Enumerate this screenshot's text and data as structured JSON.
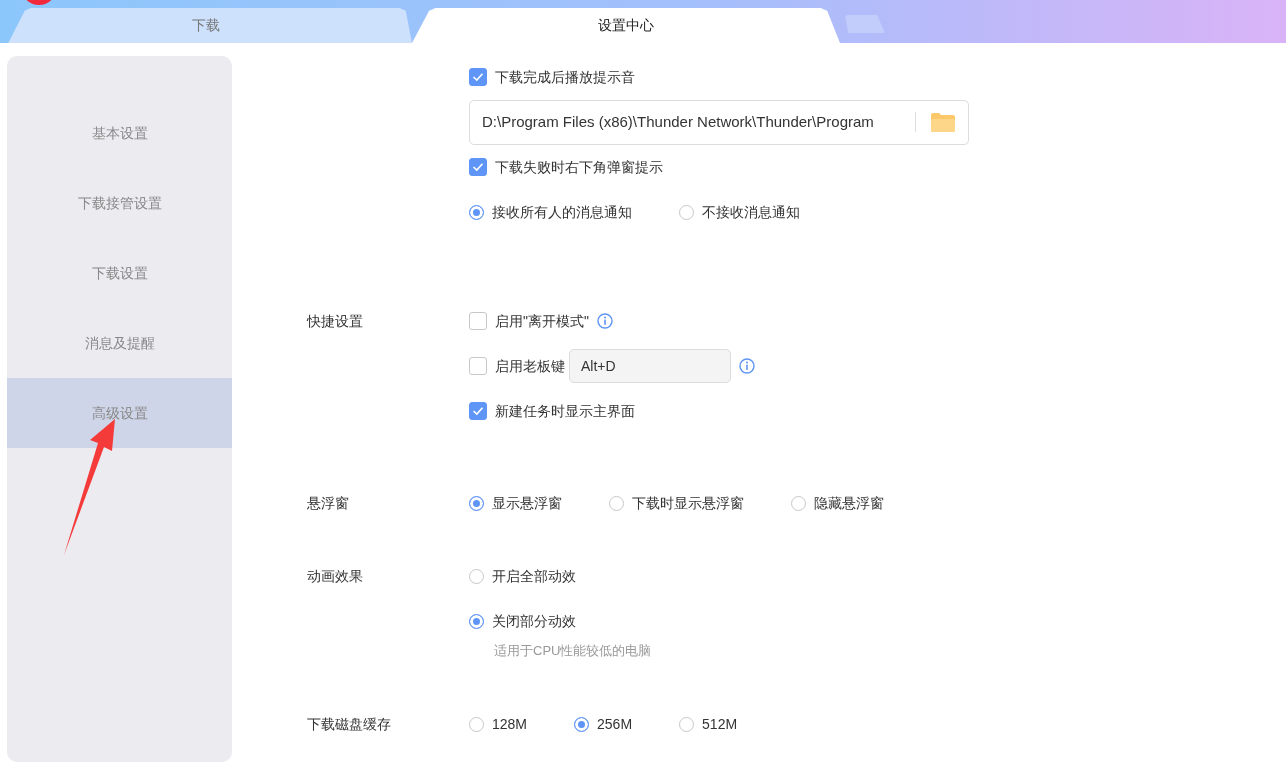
{
  "tabs": [
    {
      "label": "下载",
      "selected": false
    },
    {
      "label": "设置中心",
      "selected": true
    }
  ],
  "sidebar": {
    "items": [
      {
        "label": "基本设置",
        "selected": false
      },
      {
        "label": "下载接管设置",
        "selected": false
      },
      {
        "label": "下载设置",
        "selected": false
      },
      {
        "label": "消息及提醒",
        "selected": false
      },
      {
        "label": "高级设置",
        "selected": true
      }
    ]
  },
  "sections": [
    {
      "items": [
        {
          "kind": "checkbox",
          "label": "下载完成后播放提示音",
          "checked": true
        },
        {
          "kind": "path",
          "value": "D:\\Program Files (x86)\\Thunder Network\\Thunder\\Program"
        },
        {
          "kind": "checkbox",
          "label": "下载失败时右下角弹窗提示",
          "checked": true
        },
        {
          "kind": "radios",
          "options": [
            {
              "label": "接收所有人的消息通知",
              "selected": true
            },
            {
              "label": "不接收消息通知",
              "selected": false
            }
          ]
        }
      ]
    },
    {
      "label": "快捷设置",
      "items": [
        {
          "kind": "checkbox",
          "label": "启用\"离开模式\"",
          "checked": false,
          "info": true
        },
        {
          "kind": "checkbox",
          "label": "启用老板键",
          "checked": false,
          "hotkey": "Alt+D",
          "info": true
        },
        {
          "kind": "checkbox",
          "label": "新建任务时显示主界面",
          "checked": true
        }
      ]
    },
    {
      "label": "悬浮窗",
      "items": [
        {
          "kind": "radios",
          "options": [
            {
              "label": "显示悬浮窗",
              "selected": true
            },
            {
              "label": "下载时显示悬浮窗",
              "selected": false
            },
            {
              "label": "隐藏悬浮窗",
              "selected": false
            }
          ]
        }
      ]
    },
    {
      "label": "动画效果",
      "items": [
        {
          "kind": "radios",
          "options": [
            {
              "label": "开启全部动效",
              "selected": false
            }
          ]
        },
        {
          "kind": "radios",
          "options": [
            {
              "label": "关闭部分动效",
              "selected": true
            }
          ]
        },
        {
          "kind": "hint",
          "text": "适用于CPU性能较低的电脑"
        }
      ]
    },
    {
      "label": "下载磁盘缓存",
      "items": [
        {
          "kind": "radios",
          "options": [
            {
              "label": "128M",
              "selected": false
            },
            {
              "label": "256M",
              "selected": true
            },
            {
              "label": "512M",
              "selected": false
            }
          ]
        }
      ]
    }
  ]
}
